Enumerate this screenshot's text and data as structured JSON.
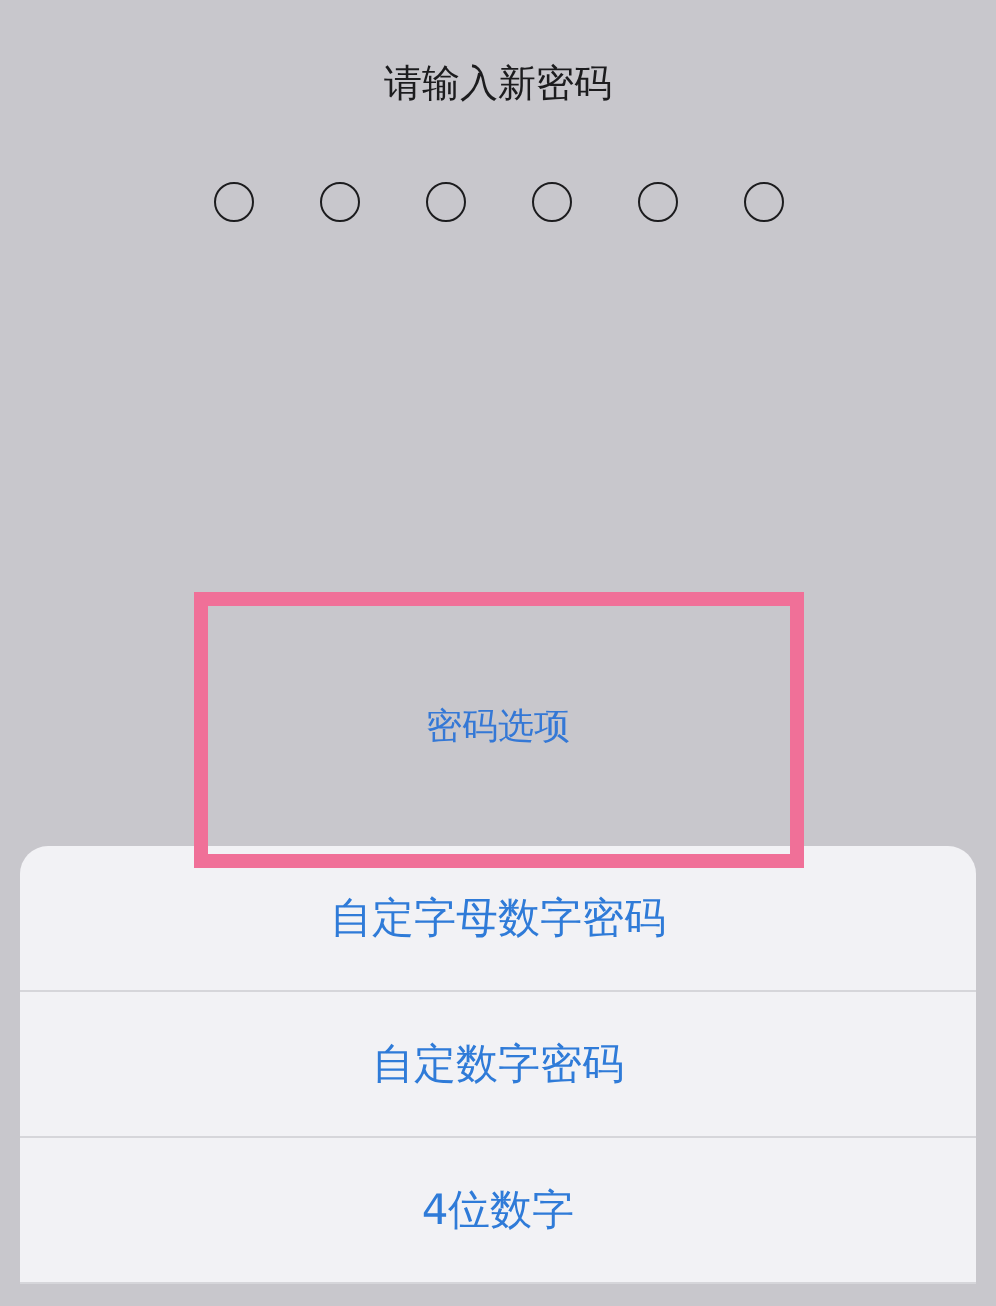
{
  "title": "请输入新密码",
  "passcode_dots": [
    {
      "filled": false
    },
    {
      "filled": false
    },
    {
      "filled": false
    },
    {
      "filled": false
    },
    {
      "filled": false
    },
    {
      "filled": false
    }
  ],
  "options_link": "密码选项",
  "sheet_options": [
    {
      "label": "自定字母数字密码"
    },
    {
      "label": "自定数字密码"
    },
    {
      "label": "4位数字"
    }
  ]
}
